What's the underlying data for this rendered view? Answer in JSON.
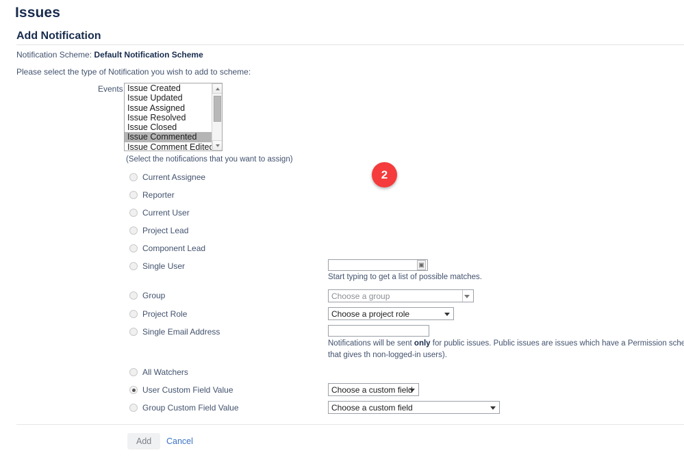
{
  "header": {
    "page_title": "Issues",
    "section_title": "Add Notification",
    "scheme_label": "Notification Scheme:",
    "scheme_name": "Default Notification Scheme",
    "instruction": "Please select the type of Notification you wish to add to scheme:"
  },
  "events": {
    "label": "Events",
    "hint": "(Select the notifications that you want to assign)",
    "options": [
      "Issue Created",
      "Issue Updated",
      "Issue Assigned",
      "Issue Resolved",
      "Issue Closed",
      "Issue Commented",
      "Issue Comment Edited"
    ],
    "selected": "Issue Commented"
  },
  "recipients": [
    {
      "id": "current-assignee",
      "label": "Current Assignee",
      "checked": false
    },
    {
      "id": "reporter",
      "label": "Reporter",
      "checked": false
    },
    {
      "id": "current-user",
      "label": "Current User",
      "checked": false
    },
    {
      "id": "project-lead",
      "label": "Project Lead",
      "checked": false
    },
    {
      "id": "component-lead",
      "label": "Component Lead",
      "checked": false
    },
    {
      "id": "single-user",
      "label": "Single User",
      "checked": false
    },
    {
      "id": "group",
      "label": "Group",
      "checked": false
    },
    {
      "id": "project-role",
      "label": "Project Role",
      "checked": false
    },
    {
      "id": "single-email",
      "label": "Single Email Address",
      "checked": false
    },
    {
      "id": "all-watchers",
      "label": "All Watchers",
      "checked": false
    },
    {
      "id": "user-custom-field",
      "label": "User Custom Field Value",
      "checked": true
    },
    {
      "id": "group-custom-field",
      "label": "Group Custom Field Value",
      "checked": false
    }
  ],
  "fields": {
    "single_user": {
      "value": "",
      "placeholder": "",
      "picker_icon": "user-picker-icon",
      "help": "Start typing to get a list of possible matches."
    },
    "group": {
      "value": "Choose a group",
      "is_placeholder": true,
      "options": [
        "Choose a group"
      ]
    },
    "project_role": {
      "value": "Choose a project role",
      "options": [
        "Choose a project role"
      ]
    },
    "single_email": {
      "value": "",
      "placeholder": "",
      "note_part1": "Notifications will be sent ",
      "note_bold": "only",
      "note_part2": " for public issues. Public issues are issues which have a Permission scheme that gives th",
      "note_line2": "non-logged-in users)."
    },
    "user_custom_field": {
      "value": "Choose a custom field",
      "options": [
        "Choose a custom field"
      ]
    },
    "group_custom_field": {
      "value": "Choose a custom field",
      "options": [
        "Choose a custom field"
      ]
    }
  },
  "footer": {
    "add_label": "Add",
    "cancel_label": "Cancel"
  },
  "annotation": {
    "badge_number": "2",
    "badge_color": "#f53b3b"
  }
}
